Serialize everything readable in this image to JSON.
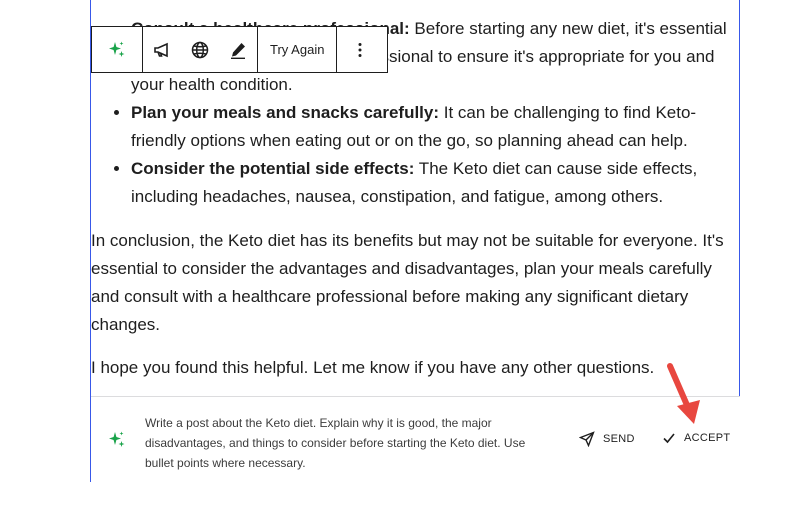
{
  "content": {
    "list_items": [
      {
        "bold": "Consult a healthcare professional:",
        "text": " Before starting any new diet, it's essential to consult with a healthcare professional to ensure it's appropriate for you and your health condition."
      },
      {
        "bold": "Plan your meals and snacks carefully:",
        "text": " It can be challenging to find Keto-friendly options when eating out or on the go, so planning ahead can help."
      },
      {
        "bold": "Consider the potential side effects:",
        "text": " The Keto diet can cause side effects, including headaches, nausea, constipation, and fatigue, among others."
      }
    ],
    "paragraph_1": "In conclusion, the Keto diet has its benefits but may not be suitable for everyone. It's essential to consider the advantages and disadvantages, plan your meals carefully and consult with a healthcare professional before making any significant dietary changes.",
    "paragraph_2": "I hope you found this helpful. Let me know if you have any other questions."
  },
  "toolbar": {
    "ai_icon": "sparkles-icon",
    "megaphone_icon": "megaphone-icon",
    "globe_icon": "globe-icon",
    "pencil_icon": "pencil-icon",
    "try_again_label": "Try Again",
    "more_icon": "more-vertical-icon"
  },
  "prompt": {
    "icon": "sparkles-icon",
    "text": "Write a post about the Keto diet. Explain why it is good, the major disadvantages, and things to consider before starting the Keto diet. Use bullet points where necessary.",
    "send_label": "SEND",
    "accept_label": "ACCEPT"
  },
  "colors": {
    "block_border": "#3858e9",
    "ai_green": "#1aa34a",
    "arrow_red": "#e8473f"
  }
}
